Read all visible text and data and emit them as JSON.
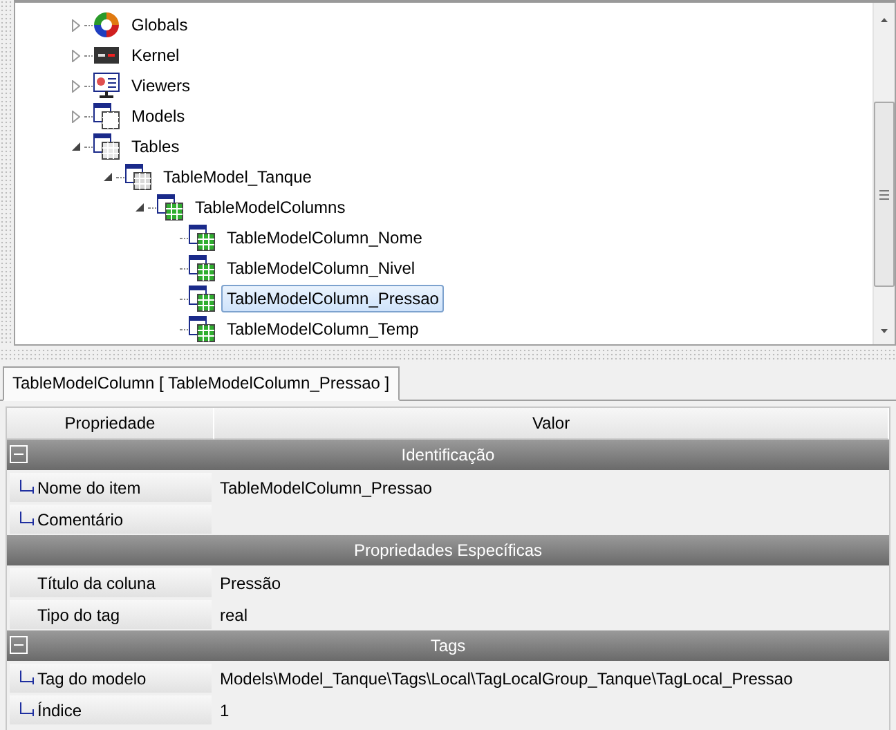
{
  "tree": [
    {
      "label": "Globals",
      "kind": "globals",
      "expanded": false,
      "selected": false
    },
    {
      "label": "Kernel",
      "kind": "kernel",
      "expanded": false,
      "selected": false
    },
    {
      "label": "Viewers",
      "kind": "viewers",
      "expanded": false,
      "selected": false
    },
    {
      "label": "Models",
      "kind": "models",
      "expanded": false,
      "selected": false
    },
    {
      "label": "Tables",
      "kind": "tables",
      "expanded": true,
      "selected": false,
      "children": [
        {
          "label": "TableModel_Tanque",
          "kind": "table",
          "expanded": true,
          "selected": false,
          "children": [
            {
              "label": "TableModelColumns",
              "kind": "columns",
              "expanded": true,
              "selected": false,
              "children": [
                {
                  "label": "TableModelColumn_Nome",
                  "kind": "column",
                  "selected": false
                },
                {
                  "label": "TableModelColumn_Nivel",
                  "kind": "column",
                  "selected": false
                },
                {
                  "label": "TableModelColumn_Pressao",
                  "kind": "column",
                  "selected": true
                },
                {
                  "label": "TableModelColumn_Temp",
                  "kind": "column",
                  "selected": false
                }
              ]
            }
          ]
        }
      ]
    }
  ],
  "tabs": [
    {
      "label": "TableModelColumn [ TableModelColumn_Pressao ]",
      "selected": true
    }
  ],
  "grid": {
    "columns": [
      "Propriedade",
      "Valor"
    ],
    "sections": [
      {
        "title": "Identificação",
        "collapsible": true,
        "rows": [
          {
            "name": "Nome do item",
            "value": "TableModelColumn_Pressao"
          },
          {
            "name": "Comentário"
          }
        ]
      },
      {
        "title": "Propriedades Específicas",
        "collapsible": false,
        "rows": [
          {
            "name": "Título da coluna",
            "value": "Pressão"
          },
          {
            "name": "Tipo do tag",
            "value": "real"
          }
        ]
      },
      {
        "title": "Tags",
        "collapsible": true,
        "rows": [
          {
            "name": "Tag do modelo",
            "value": "Models\\Model_Tanque\\Tags\\Local\\TagLocalGroup_Tanque\\TagLocal_Pressao"
          },
          {
            "name": "Índice",
            "value": "1"
          }
        ]
      }
    ]
  }
}
